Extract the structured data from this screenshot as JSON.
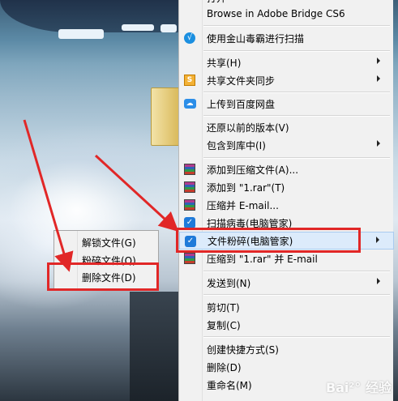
{
  "menu": {
    "top_partial": "打开",
    "items": {
      "bridge": "Browse in Adobe Bridge CS6",
      "kingsoft_scan": "使用金山毒霸进行扫描",
      "share": "共享(H)",
      "share_sync": "共享文件夹同步",
      "upload_baidu": "上传到百度网盘",
      "restore": "还原以前的版本(V)",
      "include_library": "包含到库中(I)",
      "add_archive": "添加到压缩文件(A)...",
      "add_to_rar": "添加到 \"1.rar\"(T)",
      "compress_email": "压缩并 E-mail...",
      "scan_virus": "扫描病毒(电脑管家)",
      "shred": "文件粉碎(电脑管家)",
      "compress_rar_email": "压缩到 \"1.rar\" 并 E-mail",
      "send_to": "发送到(N)",
      "cut": "剪切(T)",
      "copy": "复制(C)",
      "create_shortcut": "创建快捷方式(S)",
      "delete": "删除(D)",
      "rename": "重命名(M)"
    }
  },
  "submenu": {
    "unlock": "解锁文件(G)",
    "shred": "粉碎文件(Q)",
    "delete": "删除文件(D)"
  },
  "icons": {
    "kingsoft": "√",
    "share_sync": "S",
    "baidu": "☁",
    "shield": "✓"
  },
  "watermark": "Bai²° 经验",
  "colors": {
    "highlight_red": "#e12727",
    "menu_bg": "#f1f1f1",
    "hover_bg": "#dcebfb"
  }
}
